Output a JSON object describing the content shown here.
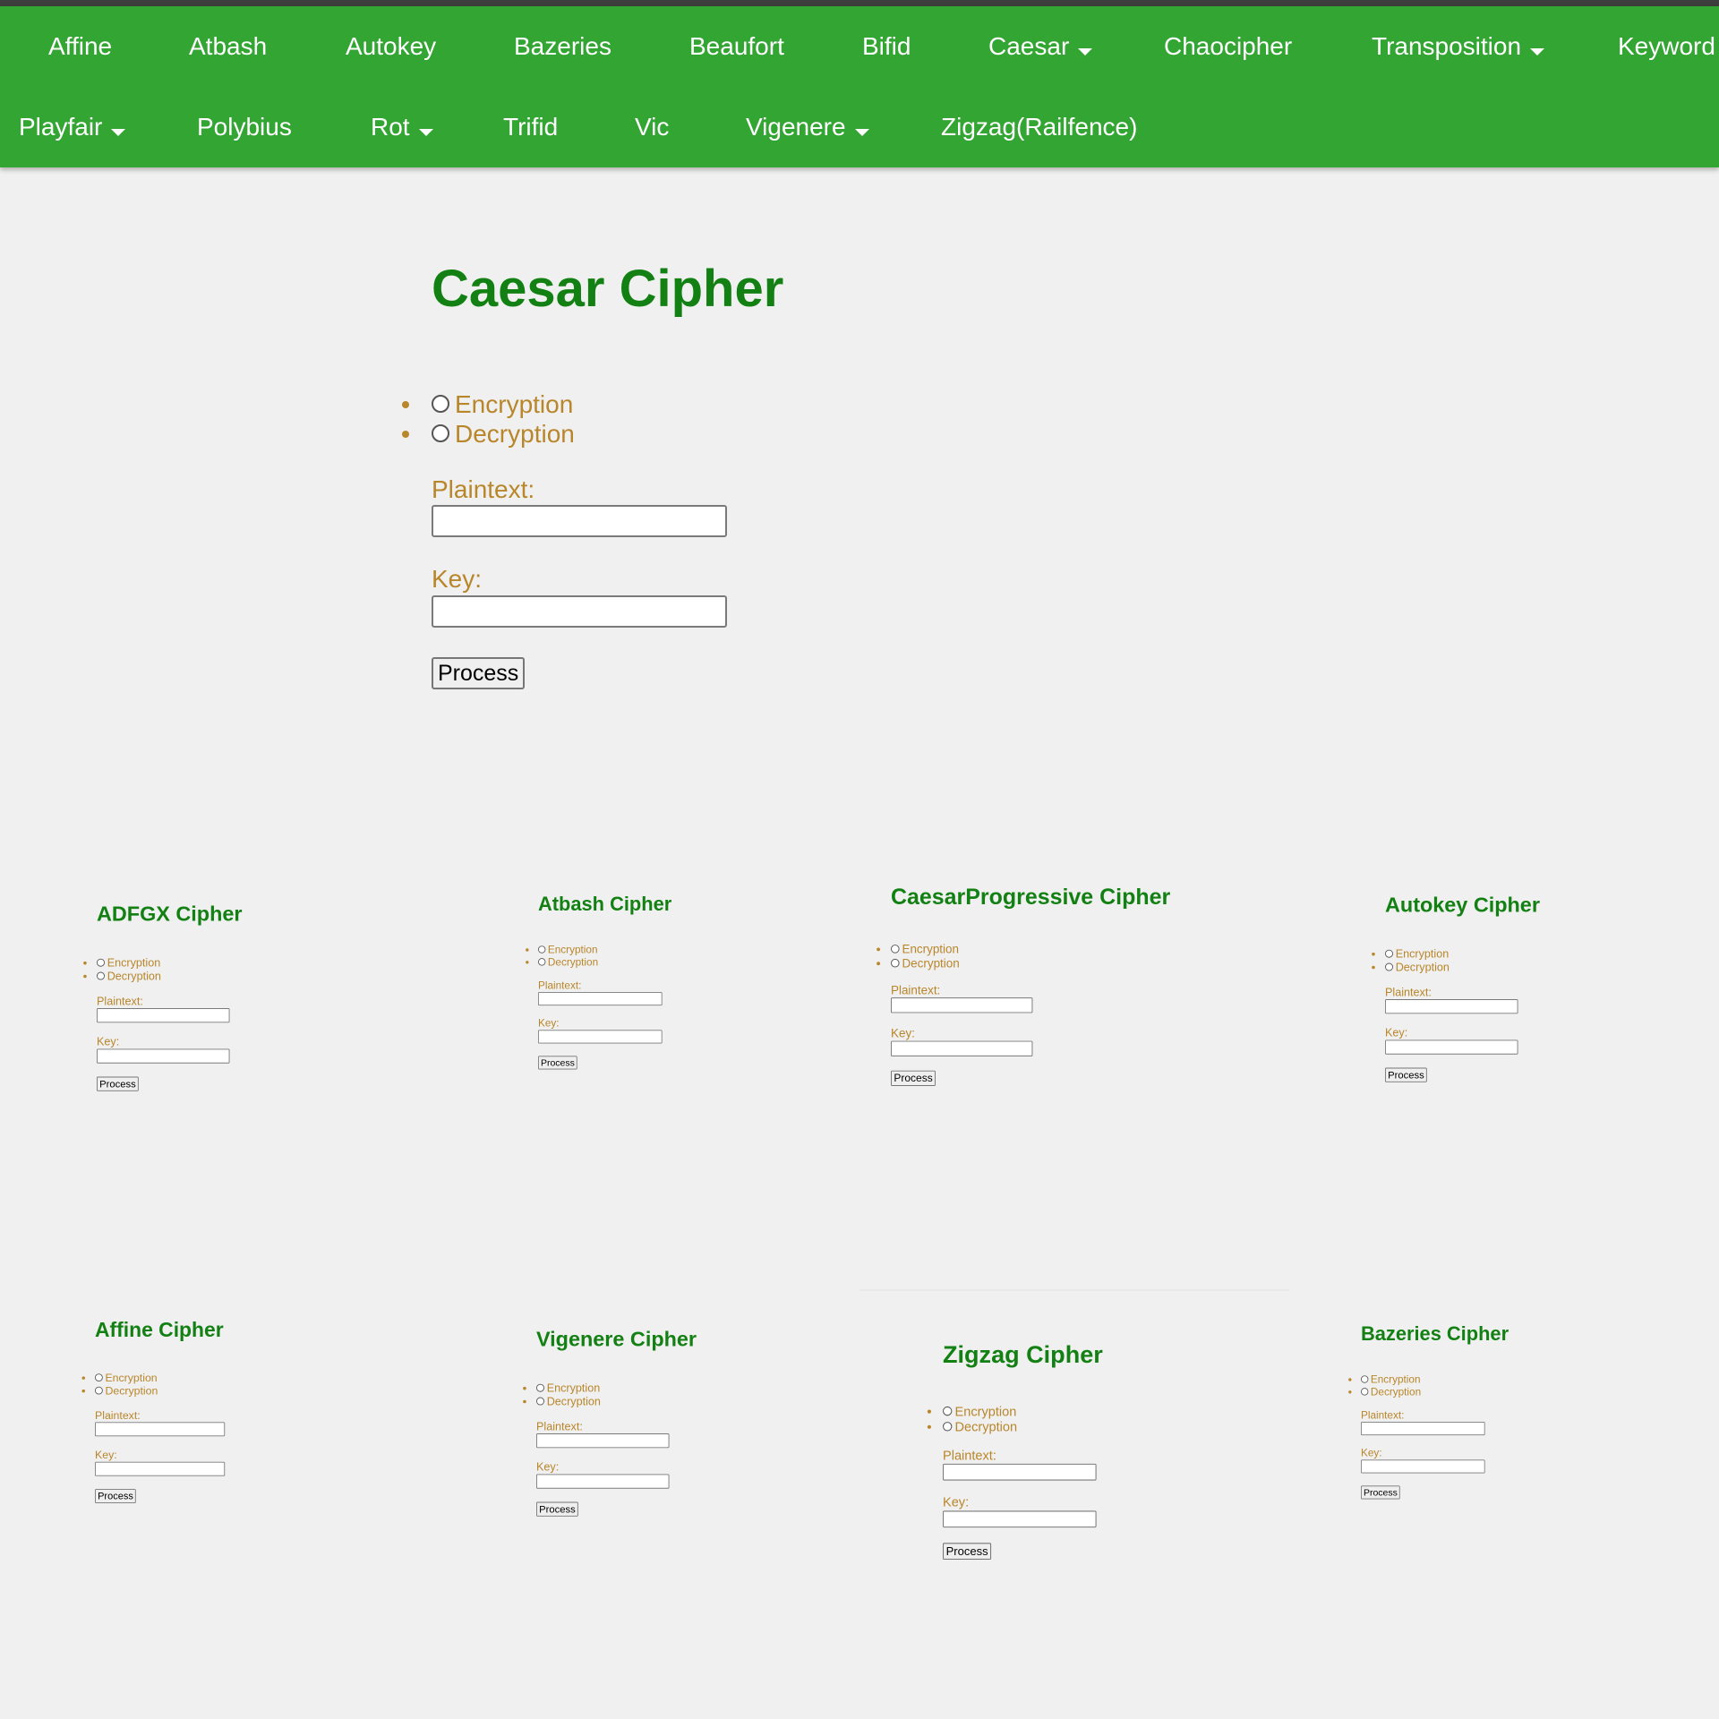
{
  "nav": {
    "row1": [
      {
        "label": "Affine",
        "dropdown": false
      },
      {
        "label": "Atbash",
        "dropdown": false
      },
      {
        "label": "Autokey",
        "dropdown": false
      },
      {
        "label": "Bazeries",
        "dropdown": false
      },
      {
        "label": "Beaufort",
        "dropdown": false
      },
      {
        "label": "Bifid",
        "dropdown": false
      },
      {
        "label": "Caesar",
        "dropdown": true
      },
      {
        "label": "Chaocipher",
        "dropdown": false
      },
      {
        "label": "Transposition",
        "dropdown": true
      },
      {
        "label": "Keyword",
        "dropdown": false
      }
    ],
    "row2": [
      {
        "label": "Playfair",
        "dropdown": true
      },
      {
        "label": "Polybius",
        "dropdown": false
      },
      {
        "label": "Rot",
        "dropdown": true
      },
      {
        "label": "Trifid",
        "dropdown": false
      },
      {
        "label": "Vic",
        "dropdown": false
      },
      {
        "label": "Vigenere",
        "dropdown": true
      },
      {
        "label": "Zigzag(Railfence)",
        "dropdown": false
      }
    ]
  },
  "colors": {
    "nav_background": "#33a533",
    "title": "#128012",
    "label": "#b8862b",
    "page_background": "#f0f0f0"
  },
  "form": {
    "encryption_label": "Encryption",
    "decryption_label": "Decryption",
    "plaintext_label": "Plaintext:",
    "key_label": "Key:",
    "plaintext_value": "",
    "key_value": "",
    "button_label": "Process"
  },
  "main_widget": {
    "title": "Caesar Cipher"
  },
  "thumbnails": [
    {
      "title": "ADFGX Cipher"
    },
    {
      "title": "Atbash Cipher"
    },
    {
      "title": "CaesarProgressive Cipher"
    },
    {
      "title": "Autokey Cipher"
    },
    {
      "title": "Affine Cipher"
    },
    {
      "title": "Vigenere Cipher"
    },
    {
      "title": "Zigzag Cipher"
    },
    {
      "title": "Bazeries Cipher"
    }
  ]
}
